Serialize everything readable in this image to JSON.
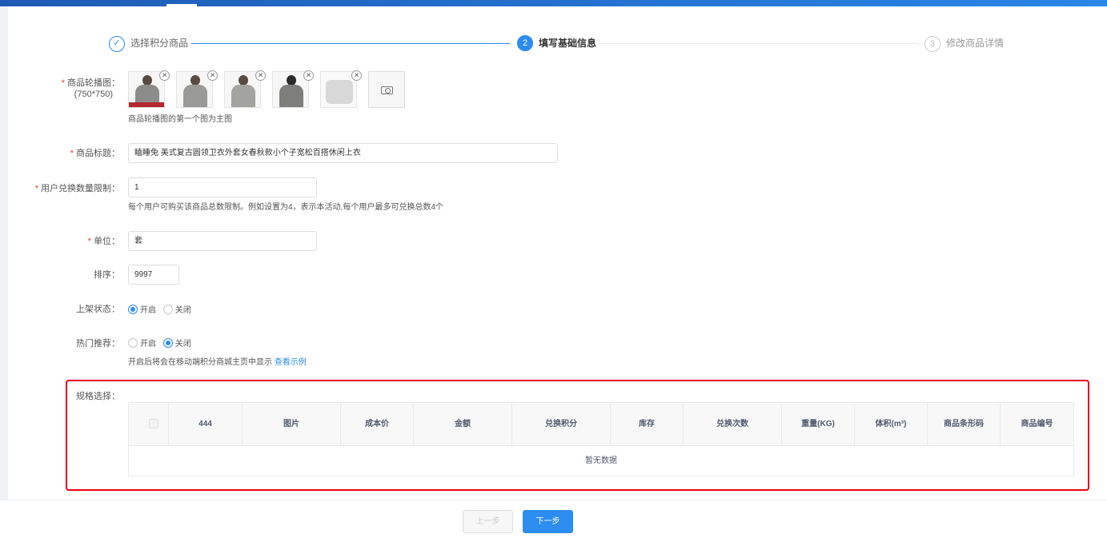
{
  "steps": [
    {
      "index": "✓",
      "title": "选择积分商品",
      "state": "done"
    },
    {
      "index": "2",
      "title": "填写基础信息",
      "state": "active"
    },
    {
      "index": "3",
      "title": "修改商品详情",
      "state": "todo"
    }
  ],
  "form": {
    "carousel": {
      "label": "商品轮播图：",
      "size_hint": "(750*750)",
      "hint": "商品轮播图的第一个图为主图",
      "remove_glyph": "×"
    },
    "title": {
      "label": "商品标题：",
      "value": "瞌睡兔 美式复古圆领卫衣外套女春秋款小个子宽松百搭休闲上衣"
    },
    "limit": {
      "label": "用户兑换数量限制：",
      "value": "1",
      "hint": "每个用户可购买该商品总数限制。例如设置为4，表示本活动,每个用户最多可兑换总数4个"
    },
    "unit": {
      "label": "单位：",
      "value": "套"
    },
    "sort": {
      "label": "排序：",
      "value": "9997"
    },
    "shelf_status": {
      "label": "上架状态：",
      "options": [
        "开启",
        "关闭"
      ],
      "selected": "开启"
    },
    "hot": {
      "label": "热门推荐：",
      "options": [
        "开启",
        "关闭"
      ],
      "selected": "关闭",
      "hint": "开启后将会在移动端积分商城主页中显示",
      "link": "查看示例"
    }
  },
  "spec": {
    "label": "规格选择：",
    "columns": [
      "444",
      "图片",
      "成本价",
      "金额",
      "兑换积分",
      "库存",
      "兑换次数",
      "重量(KG)",
      "体积(m³)",
      "商品条形码",
      "商品编号"
    ],
    "empty_text": "暂无数据"
  },
  "footer": {
    "prev_label": "上一步",
    "next_label": "下一步"
  },
  "colors": {
    "primary": "#2d8cf0",
    "required": "#ed4014",
    "highlight_border": "#e60012"
  },
  "icons": {
    "upload": "camera-icon",
    "remove": "close-icon",
    "done_step": "check-icon"
  }
}
